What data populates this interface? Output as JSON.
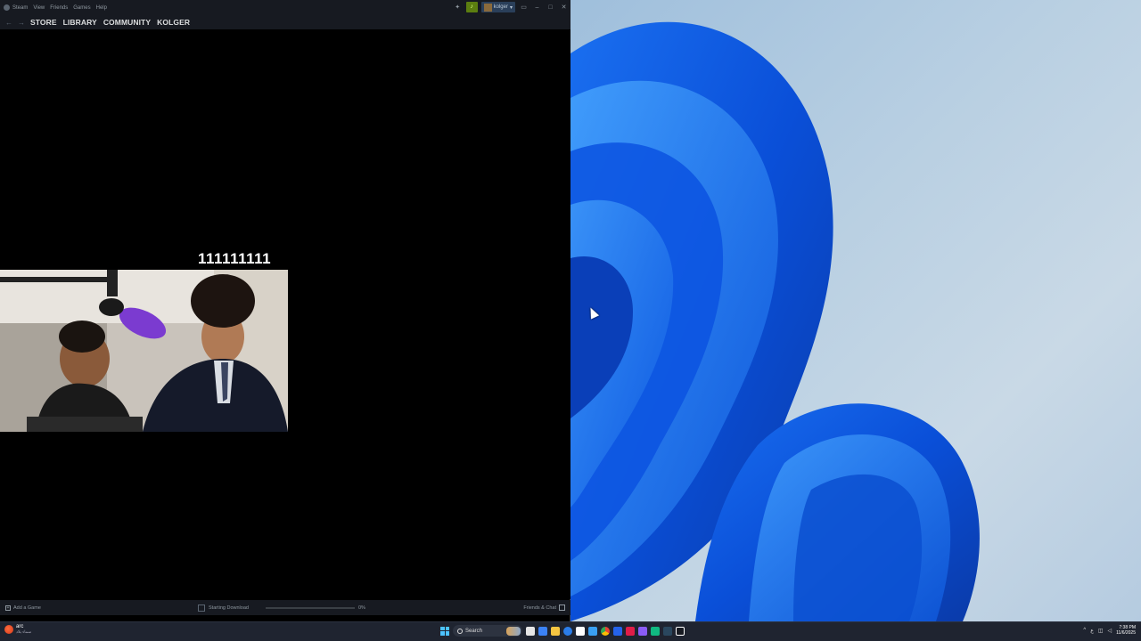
{
  "steam": {
    "menu": [
      "Steam",
      "View",
      "Friends",
      "Games",
      "Help"
    ],
    "user": "kolger",
    "nav": {
      "back": "←",
      "forward": "→",
      "items": [
        "STORE",
        "LIBRARY",
        "COMMUNITY",
        "KOLGER"
      ]
    },
    "window_controls": {
      "minimize": "–",
      "maximize": "□",
      "close": "✕"
    },
    "overlay_text": "111111111",
    "status": {
      "add_game": "Add a Game",
      "download_label": "Starting Download",
      "download_percent": "0%",
      "download_progress": 0,
      "friends": "Friends & Chat"
    }
  },
  "taskbar": {
    "arc_title": "arc",
    "arc_sub": "سماء بلاد",
    "search_placeholder": "Search",
    "clock_time": "7:38 PM",
    "clock_date": "11/6/2025",
    "tray_chevron": "^",
    "tray_lang": "ع"
  },
  "icons": {
    "accent": "#1a9fff",
    "steam_bg": "#171a21",
    "taskbar_bg": "#1f2430"
  }
}
